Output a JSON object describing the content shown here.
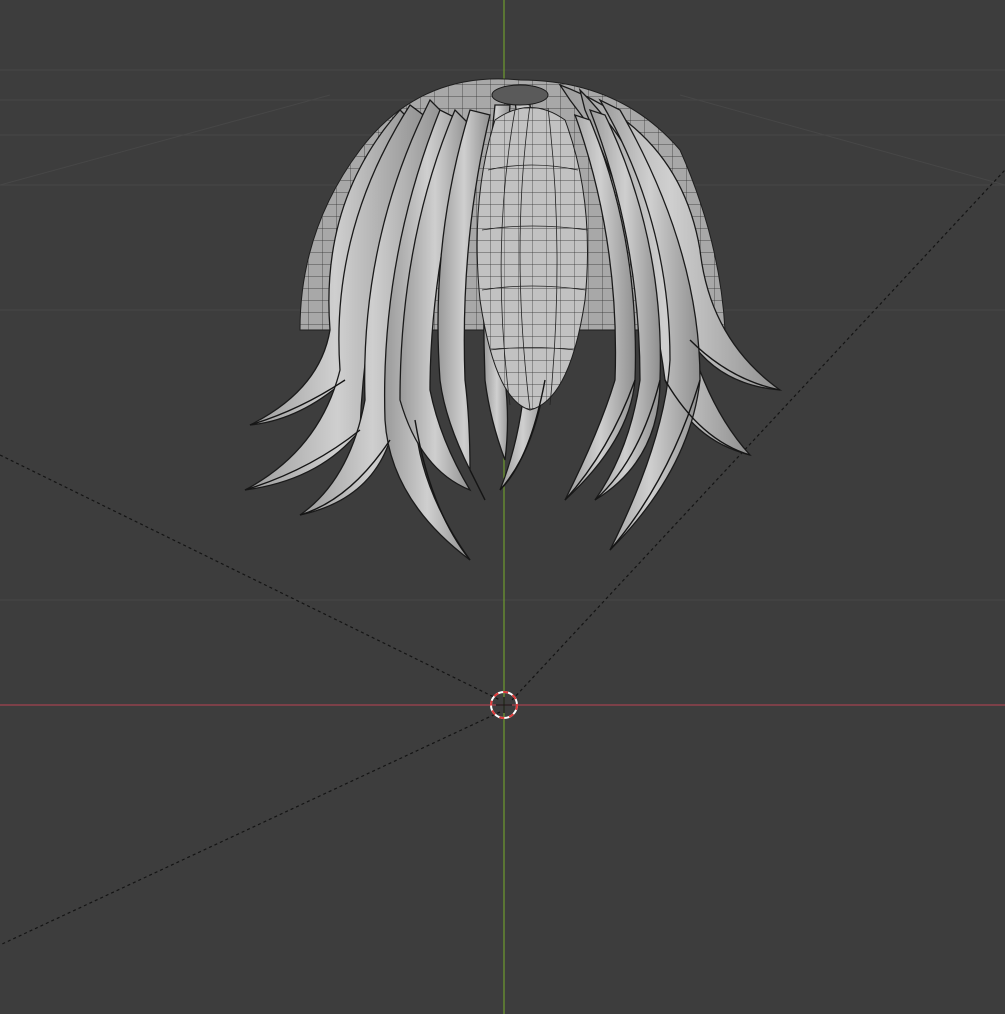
{
  "viewport": {
    "background": "#3d3d3d",
    "grid_color": "#4a4a4a",
    "x_axis_color": "#a3434f",
    "y_axis_color": "#6e9b2e",
    "camera_frustum_color": "#111111"
  },
  "scene": {
    "objects": [
      {
        "name": "hair-mesh",
        "shading": "solid",
        "overlay": "wireframe",
        "mesh_color": "#bdbdbd",
        "wire_color": "#1e1e1e"
      }
    ],
    "cursor": {
      "name": "3d-cursor",
      "colors": [
        "#e03b3b",
        "#ffffff"
      ]
    }
  }
}
